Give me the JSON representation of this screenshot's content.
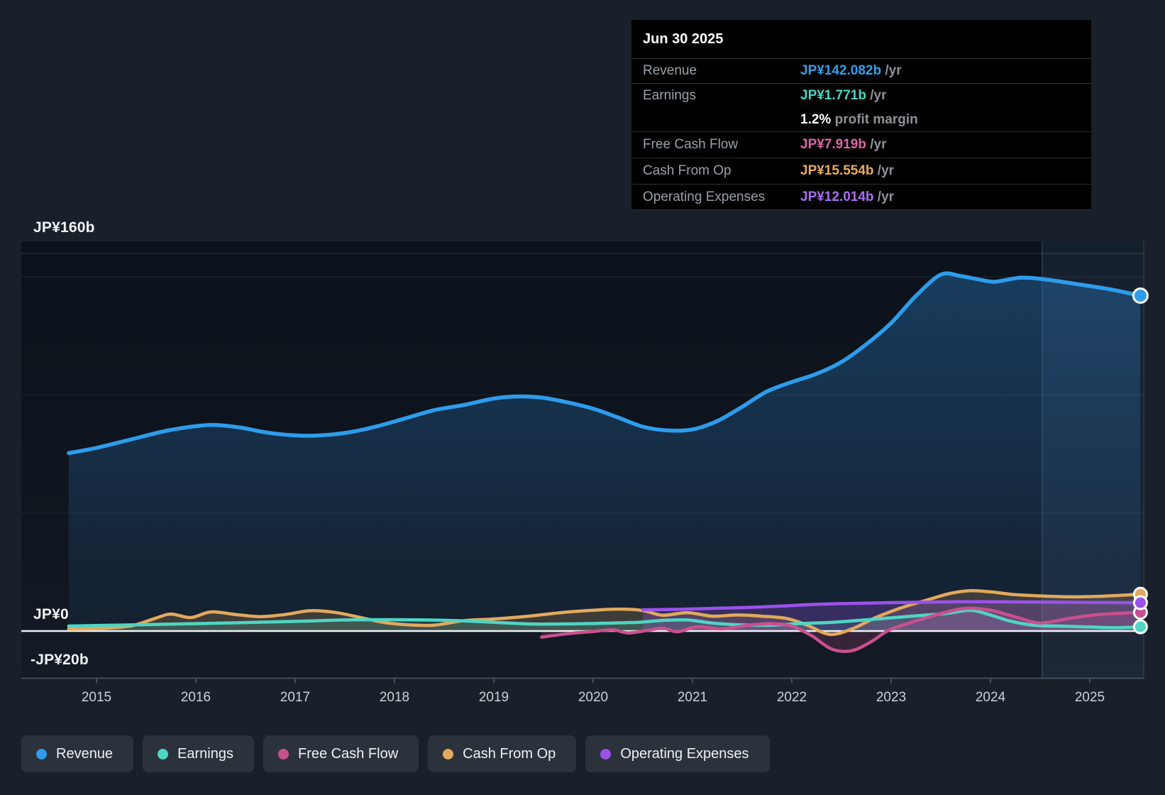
{
  "tooltip": {
    "date": "Jun 30 2025",
    "rows": [
      {
        "label": "Revenue",
        "value": "JP¥142.082b",
        "suffix": " /yr",
        "color": "#2f9fe9"
      },
      {
        "label": "Earnings",
        "value": "JP¥1.771b",
        "suffix": " /yr",
        "color": "#43d9c6"
      },
      {
        "label": "",
        "value": "1.2%",
        "suffix": " profit margin",
        "color": "#ffffff"
      },
      {
        "label": "Free Cash Flow",
        "value": "JP¥7.919b",
        "suffix": " /yr",
        "color": "#dc64a4"
      },
      {
        "label": "Cash From Op",
        "value": "JP¥15.554b",
        "suffix": " /yr",
        "color": "#e9ab58"
      },
      {
        "label": "Operating Expenses",
        "value": "JP¥12.014b",
        "suffix": " /yr",
        "color": "#ab6cf5"
      }
    ]
  },
  "y_axis": {
    "top": "JP¥160b",
    "zero": "JP¥0",
    "bottom": "-JP¥20b"
  },
  "x_axis": {
    "labels": [
      "2015",
      "2016",
      "2017",
      "2018",
      "2019",
      "2020",
      "2021",
      "2022",
      "2023",
      "2024",
      "2025"
    ]
  },
  "legend": [
    {
      "label": "Revenue",
      "color": "#2d9cec"
    },
    {
      "label": "Earnings",
      "color": "#4fd5c3"
    },
    {
      "label": "Free Cash Flow",
      "color": "#c9508e"
    },
    {
      "label": "Cash From Op",
      "color": "#e2a95d"
    },
    {
      "label": "Operating Expenses",
      "color": "#9b52ea"
    }
  ],
  "chart_data": {
    "type": "area",
    "title": "Earnings and revenue history (JP¥ billions per year)",
    "x_unit": "year",
    "xlim": [
      2014.25,
      2025.55
    ],
    "ylim": [
      -20,
      165
    ],
    "y_gridlines": [
      160,
      150,
      100,
      50,
      0,
      -20
    ],
    "highlight_band": {
      "from": 2024.52,
      "to": 2025.545,
      "meaning": "last 12 months"
    },
    "hover_point": {
      "date": "Jun 30 2025",
      "x": 2025.5
    },
    "series": [
      {
        "name": "Revenue",
        "color": "#2d9cec",
        "end_value": 142.082,
        "points": [
          [
            2014.72,
            75.4
          ],
          [
            2015.0,
            77.6
          ],
          [
            2015.35,
            81.2
          ],
          [
            2015.7,
            84.8
          ],
          [
            2016.0,
            86.8
          ],
          [
            2016.2,
            87.3
          ],
          [
            2016.45,
            86.2
          ],
          [
            2016.7,
            84.2
          ],
          [
            2016.95,
            83.0
          ],
          [
            2017.2,
            82.8
          ],
          [
            2017.5,
            83.9
          ],
          [
            2017.8,
            86.5
          ],
          [
            2018.1,
            90.0
          ],
          [
            2018.4,
            93.6
          ],
          [
            2018.7,
            95.8
          ],
          [
            2019.0,
            98.5
          ],
          [
            2019.25,
            99.4
          ],
          [
            2019.5,
            98.8
          ],
          [
            2019.75,
            96.8
          ],
          [
            2020.0,
            94.2
          ],
          [
            2020.25,
            90.5
          ],
          [
            2020.5,
            86.6
          ],
          [
            2020.75,
            85.0
          ],
          [
            2021.0,
            85.4
          ],
          [
            2021.25,
            89.0
          ],
          [
            2021.5,
            95.0
          ],
          [
            2021.75,
            101.5
          ],
          [
            2022.0,
            105.5
          ],
          [
            2022.25,
            109.0
          ],
          [
            2022.5,
            114.0
          ],
          [
            2022.75,
            121.5
          ],
          [
            2023.0,
            130.5
          ],
          [
            2023.25,
            142.0
          ],
          [
            2023.5,
            151.0
          ],
          [
            2023.7,
            150.4
          ],
          [
            2023.9,
            148.8
          ],
          [
            2024.05,
            148.0
          ],
          [
            2024.3,
            149.7
          ],
          [
            2024.55,
            149.0
          ],
          [
            2024.9,
            146.8
          ],
          [
            2025.2,
            144.8
          ],
          [
            2025.51,
            142.1
          ]
        ]
      },
      {
        "name": "Cash From Op",
        "color": "#e2a95d",
        "end_value": 15.554,
        "points": [
          [
            2014.72,
            0.9
          ],
          [
            2015.05,
            1.1
          ],
          [
            2015.35,
            2.2
          ],
          [
            2015.6,
            5.5
          ],
          [
            2015.75,
            7.2
          ],
          [
            2015.95,
            5.7
          ],
          [
            2016.15,
            8.1
          ],
          [
            2016.4,
            7.0
          ],
          [
            2016.65,
            6.1
          ],
          [
            2016.9,
            7.0
          ],
          [
            2017.15,
            8.6
          ],
          [
            2017.4,
            7.9
          ],
          [
            2017.65,
            5.8
          ],
          [
            2017.9,
            3.6
          ],
          [
            2018.15,
            2.6
          ],
          [
            2018.4,
            2.5
          ],
          [
            2018.7,
            4.4
          ],
          [
            2019.0,
            5.1
          ],
          [
            2019.35,
            6.3
          ],
          [
            2019.7,
            7.9
          ],
          [
            2020.0,
            8.8
          ],
          [
            2020.25,
            9.3
          ],
          [
            2020.5,
            8.7
          ],
          [
            2020.7,
            6.7
          ],
          [
            2020.95,
            7.8
          ],
          [
            2021.2,
            6.3
          ],
          [
            2021.45,
            6.8
          ],
          [
            2021.7,
            6.3
          ],
          [
            2021.95,
            5.3
          ],
          [
            2022.15,
            2.6
          ],
          [
            2022.38,
            -1.4
          ],
          [
            2022.6,
            0.8
          ],
          [
            2022.85,
            5.8
          ],
          [
            2023.1,
            9.8
          ],
          [
            2023.35,
            13.0
          ],
          [
            2023.6,
            16.0
          ],
          [
            2023.8,
            17.1
          ],
          [
            2024.0,
            16.6
          ],
          [
            2024.25,
            15.4
          ],
          [
            2024.5,
            14.9
          ],
          [
            2024.8,
            14.5
          ],
          [
            2025.1,
            14.7
          ],
          [
            2025.51,
            15.6
          ]
        ]
      },
      {
        "name": "Earnings",
        "color": "#4fd5c3",
        "end_value": 1.771,
        "points": [
          [
            2014.72,
            2.1
          ],
          [
            2015.2,
            2.5
          ],
          [
            2015.7,
            2.9
          ],
          [
            2016.2,
            3.3
          ],
          [
            2016.7,
            3.8
          ],
          [
            2017.1,
            4.2
          ],
          [
            2017.5,
            4.7
          ],
          [
            2017.9,
            4.8
          ],
          [
            2018.3,
            4.7
          ],
          [
            2018.7,
            4.3
          ],
          [
            2019.0,
            3.7
          ],
          [
            2019.35,
            3.0
          ],
          [
            2019.7,
            3.0
          ],
          [
            2020.1,
            3.3
          ],
          [
            2020.45,
            3.7
          ],
          [
            2020.7,
            4.5
          ],
          [
            2020.95,
            4.7
          ],
          [
            2021.2,
            3.4
          ],
          [
            2021.5,
            2.6
          ],
          [
            2021.8,
            2.5
          ],
          [
            2022.1,
            3.2
          ],
          [
            2022.4,
            3.7
          ],
          [
            2022.7,
            4.6
          ],
          [
            2023.0,
            5.6
          ],
          [
            2023.3,
            6.6
          ],
          [
            2023.55,
            7.4
          ],
          [
            2023.8,
            8.8
          ],
          [
            2024.0,
            6.8
          ],
          [
            2024.2,
            4.2
          ],
          [
            2024.45,
            2.4
          ],
          [
            2024.7,
            2.1
          ],
          [
            2025.0,
            1.7
          ],
          [
            2025.25,
            1.4
          ],
          [
            2025.51,
            1.8
          ]
        ]
      },
      {
        "name": "Free Cash Flow",
        "color": "#c9508e",
        "end_value": 7.919,
        "points": [
          [
            2019.48,
            -2.6
          ],
          [
            2019.75,
            -1.1
          ],
          [
            2020.0,
            -0.2
          ],
          [
            2020.2,
            0.5
          ],
          [
            2020.35,
            -0.8
          ],
          [
            2020.55,
            0.3
          ],
          [
            2020.7,
            1.2
          ],
          [
            2020.85,
            -0.3
          ],
          [
            2021.05,
            1.8
          ],
          [
            2021.3,
            0.9
          ],
          [
            2021.55,
            2.4
          ],
          [
            2021.8,
            3.1
          ],
          [
            2022.0,
            2.1
          ],
          [
            2022.2,
            -2.0
          ],
          [
            2022.4,
            -7.6
          ],
          [
            2022.6,
            -8.4
          ],
          [
            2022.8,
            -4.5
          ],
          [
            2022.97,
            0.2
          ],
          [
            2023.2,
            3.6
          ],
          [
            2023.5,
            7.4
          ],
          [
            2023.75,
            9.6
          ],
          [
            2024.0,
            8.8
          ],
          [
            2024.25,
            6.0
          ],
          [
            2024.5,
            3.4
          ],
          [
            2024.8,
            5.4
          ],
          [
            2025.1,
            7.0
          ],
          [
            2025.51,
            7.9
          ]
        ]
      },
      {
        "name": "Operating Expenses",
        "color": "#9b52ea",
        "end_value": 12.014,
        "points": [
          [
            2020.5,
            9.0
          ],
          [
            2020.85,
            9.2
          ],
          [
            2021.2,
            9.6
          ],
          [
            2021.55,
            10.0
          ],
          [
            2021.9,
            10.6
          ],
          [
            2022.25,
            11.3
          ],
          [
            2022.6,
            11.7
          ],
          [
            2022.95,
            12.0
          ],
          [
            2023.3,
            12.2
          ],
          [
            2023.65,
            12.4
          ],
          [
            2024.0,
            12.4
          ],
          [
            2024.35,
            12.3
          ],
          [
            2024.7,
            12.2
          ],
          [
            2025.05,
            12.1
          ],
          [
            2025.51,
            12.0
          ]
        ]
      }
    ]
  }
}
